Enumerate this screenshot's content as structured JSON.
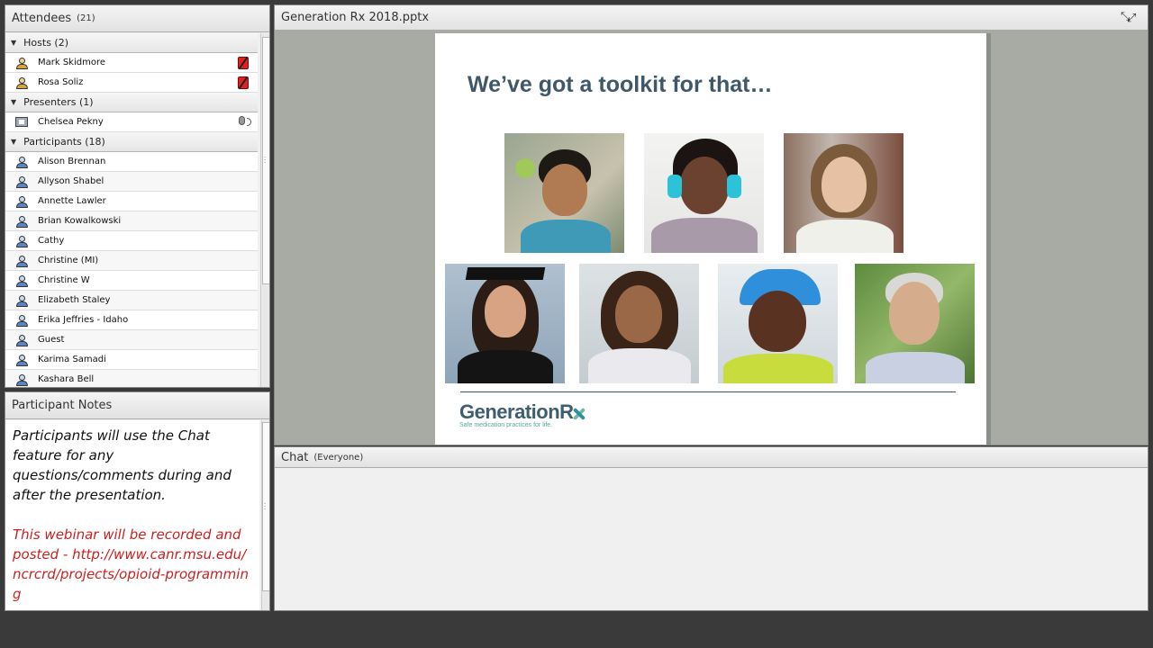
{
  "attendees": {
    "title": "Attendees",
    "count": "(21)",
    "groups": [
      {
        "label": "Hosts (2)",
        "role": "host",
        "people": [
          {
            "name": "Mark Skidmore",
            "status": "mic-muted-icon"
          },
          {
            "name": "Rosa Soliz",
            "status": "mic-muted-icon"
          }
        ]
      },
      {
        "label": "Presenters (1)",
        "role": "presenter",
        "people": [
          {
            "name": "Chelsea Pekny",
            "status": "mic-active-icon"
          }
        ]
      },
      {
        "label": "Participants (18)",
        "role": "participant",
        "people": [
          {
            "name": "Alison Brennan"
          },
          {
            "name": "Allyson Shabel"
          },
          {
            "name": "Annette Lawler"
          },
          {
            "name": "Brian Kowalkowski"
          },
          {
            "name": "Cathy"
          },
          {
            "name": "Christine (MI)"
          },
          {
            "name": "Christine W"
          },
          {
            "name": "Elizabeth Staley"
          },
          {
            "name": "Erika Jeffries - Idaho"
          },
          {
            "name": "Guest"
          },
          {
            "name": "Karima Samadi"
          },
          {
            "name": "Kashara Bell"
          }
        ]
      }
    ]
  },
  "notes": {
    "title": "Participant Notes",
    "paragraph1": "Participants will use the Chat feature for any questions/comments during and after the presentation.",
    "paragraph2": "This webinar will be recorded and posted - http://www.canr.msu.edu/ncrcrd/projects/opioid-programming",
    "highlight_color": "#cc1f1f"
  },
  "share": {
    "title": "Generation Rx 2018.pptx",
    "fullscreen_icon": "fullscreen-icon",
    "slide": {
      "heading": "We’ve got a toolkit for that…",
      "logo_text": "GenerationR",
      "logo_tagline": "Safe medication practices for life.",
      "heading_color": "#3e5869"
    }
  },
  "chat": {
    "title": "Chat",
    "scope": "(Everyone)"
  }
}
